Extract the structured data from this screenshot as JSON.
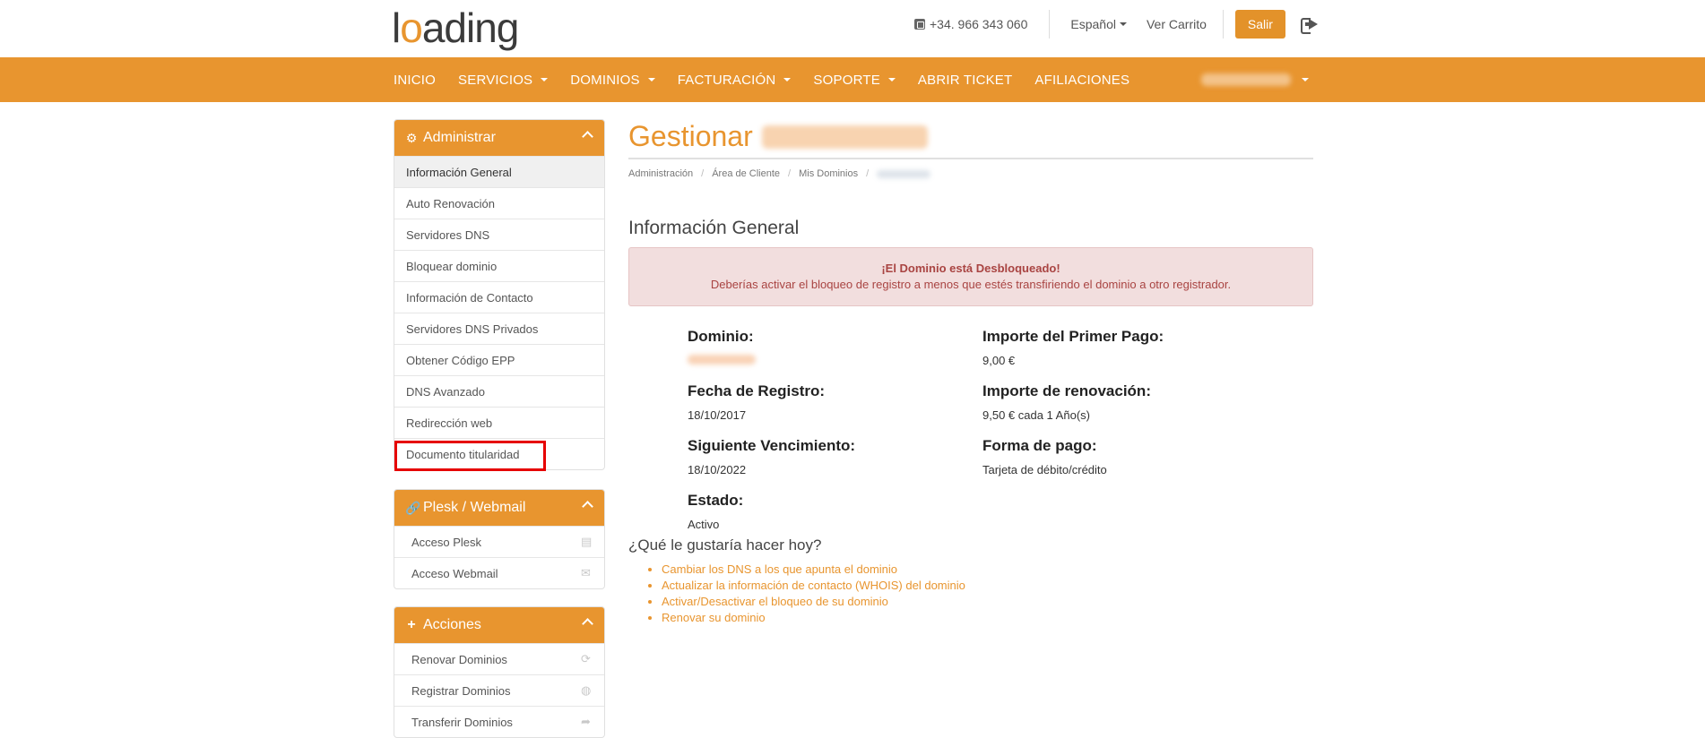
{
  "header": {
    "logo_text_pre": "l",
    "logo_text_o": "o",
    "logo_text_post": "ading",
    "phone": "+34. 966 343 060",
    "language": "Español",
    "cart": "Ver Carrito",
    "logout_button": "Salir"
  },
  "nav": {
    "items": [
      {
        "label": "INICIO",
        "dropdown": false
      },
      {
        "label": "SERVICIOS",
        "dropdown": true
      },
      {
        "label": "DOMINIOS",
        "dropdown": true
      },
      {
        "label": "FACTURACIÓN",
        "dropdown": true
      },
      {
        "label": "SOPORTE",
        "dropdown": true
      },
      {
        "label": "ABRIR TICKET",
        "dropdown": false
      },
      {
        "label": "AFILIACIONES",
        "dropdown": false
      }
    ]
  },
  "sidebar": {
    "admin": {
      "title": "Administrar",
      "items": [
        "Información General",
        "Auto Renovación",
        "Servidores DNS",
        "Bloquear dominio",
        "Información de Contacto",
        "Servidores DNS Privados",
        "Obtener Código EPP",
        "DNS Avanzado",
        "Redirección web",
        "Documento titularidad"
      ]
    },
    "plesk": {
      "title": "Plesk / Webmail",
      "items": [
        "Acceso Plesk",
        "Acceso Webmail"
      ]
    },
    "acciones": {
      "title": "Acciones",
      "items": [
        "Renovar Dominios",
        "Registrar Dominios",
        "Transferir Dominios"
      ]
    }
  },
  "main": {
    "title": "Gestionar",
    "breadcrumb": [
      "Administración",
      "Área de Cliente",
      "Mis Dominios"
    ],
    "section_title": "Información General",
    "alert": {
      "heading": "¡El Dominio está Desbloqueado!",
      "text": "Deberías activar el bloqueo de registro a menos que estés transfiriendo el dominio a otro registrador."
    },
    "info_left": [
      {
        "label": "Dominio:",
        "value": ""
      },
      {
        "label": "Fecha de Registro:",
        "value": "18/10/2017"
      },
      {
        "label": "Siguiente Vencimiento:",
        "value": "18/10/2022"
      },
      {
        "label": "Estado:",
        "value": "Activo"
      }
    ],
    "info_right": [
      {
        "label": "Importe del Primer Pago:",
        "value": "9,00 €"
      },
      {
        "label": "Importe de renovación:",
        "value": "9,50 € cada 1 Año(s)"
      },
      {
        "label": "Forma de pago:",
        "value": "Tarjeta de débito/crédito"
      }
    ],
    "question": "¿Qué le gustaría hacer hoy?",
    "actions": [
      "Cambiar los DNS a los que apunta el dominio",
      "Actualizar la información de contacto (WHOIS) del dominio",
      "Activar/Desactivar el bloqueo de su dominio",
      "Renovar su dominio"
    ]
  },
  "colors": {
    "brand_orange": "#e8952f",
    "alert_bg": "#f2dede",
    "alert_text": "#a94442",
    "highlight_red": "#e60000"
  }
}
